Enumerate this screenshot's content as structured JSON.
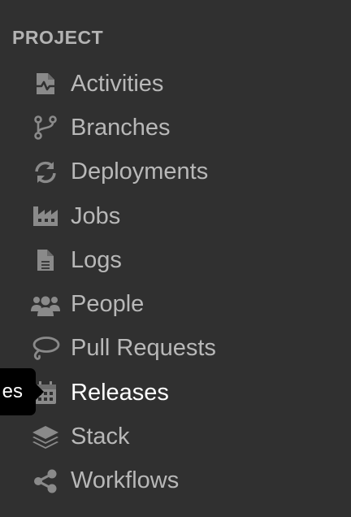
{
  "sidebar": {
    "section_title": "PROJECT",
    "icon_color": "#8a8a8a",
    "label_color": "#b8b8b8",
    "active_label_color": "#ffffff",
    "items": [
      {
        "label": "Activities",
        "icon": "activity-file-icon"
      },
      {
        "label": "Branches",
        "icon": "branch-icon"
      },
      {
        "label": "Deployments",
        "icon": "refresh-icon"
      },
      {
        "label": "Jobs",
        "icon": "factory-icon"
      },
      {
        "label": "Logs",
        "icon": "log-file-icon"
      },
      {
        "label": "People",
        "icon": "people-icon"
      },
      {
        "label": "Pull Requests",
        "icon": "lasso-icon"
      },
      {
        "label": "Releases",
        "icon": "calendar-icon",
        "active": true
      },
      {
        "label": "Stack",
        "icon": "layers-icon"
      },
      {
        "label": "Workflows",
        "icon": "share-nodes-icon"
      }
    ]
  },
  "tooltip": {
    "text": "es"
  }
}
